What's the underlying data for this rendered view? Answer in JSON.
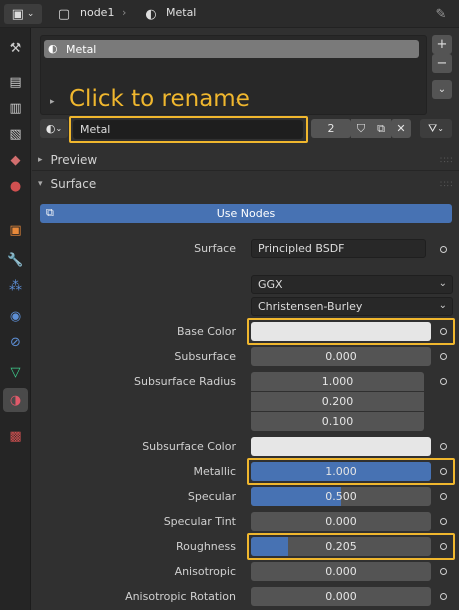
{
  "header": {
    "object_name": "node1",
    "material_name": "Metal",
    "icons": [
      "editor-type-icon",
      "object-icon",
      "material-sphere-icon",
      "pin-icon"
    ]
  },
  "tabs": [
    "tool-icon",
    "render-icon",
    "output-icon",
    "view-layer-icon",
    "scene-icon",
    "world-icon",
    "object-icon",
    "modifier-icon",
    "particles-icon",
    "physics-icon",
    "constraints-icon",
    "data-icon",
    "material-icon",
    "texture-icon"
  ],
  "slots": {
    "items": [
      "Metal"
    ]
  },
  "annotation": {
    "text": "Click to rename",
    "color": "#f0b72e"
  },
  "material": {
    "name": "Metal",
    "users": "2"
  },
  "panels": {
    "preview": "Preview",
    "surface": "Surface"
  },
  "use_nodes": "Use Nodes",
  "surface_shader": {
    "label": "Surface",
    "value": "Principled BSDF"
  },
  "distribution": "GGX",
  "subsurface_method": "Christensen-Burley",
  "properties": {
    "base_color": {
      "label": "Base Color",
      "color": "#e6e6e6"
    },
    "subsurface": {
      "label": "Subsurface",
      "value": "0.000",
      "fraction": 0
    },
    "subsurface_radius": {
      "label": "Subsurface Radius",
      "values": [
        "1.000",
        "0.200",
        "0.100"
      ]
    },
    "subsurface_color": {
      "label": "Subsurface Color",
      "color": "#e6e6e6"
    },
    "metallic": {
      "label": "Metallic",
      "value": "1.000",
      "fraction": 1.0
    },
    "specular": {
      "label": "Specular",
      "value": "0.500",
      "fraction": 0.5
    },
    "specular_tint": {
      "label": "Specular Tint",
      "value": "0.000",
      "fraction": 0
    },
    "roughness": {
      "label": "Roughness",
      "value": "0.205",
      "fraction": 0.205
    },
    "anisotropic": {
      "label": "Anisotropic",
      "value": "0.000",
      "fraction": 0
    },
    "anisotropic_rotation": {
      "label": "Anisotropic Rotation",
      "value": "0.000",
      "fraction": 0
    }
  },
  "colors": {
    "accent": "#4772b3",
    "highlight": "#f0b72e"
  }
}
